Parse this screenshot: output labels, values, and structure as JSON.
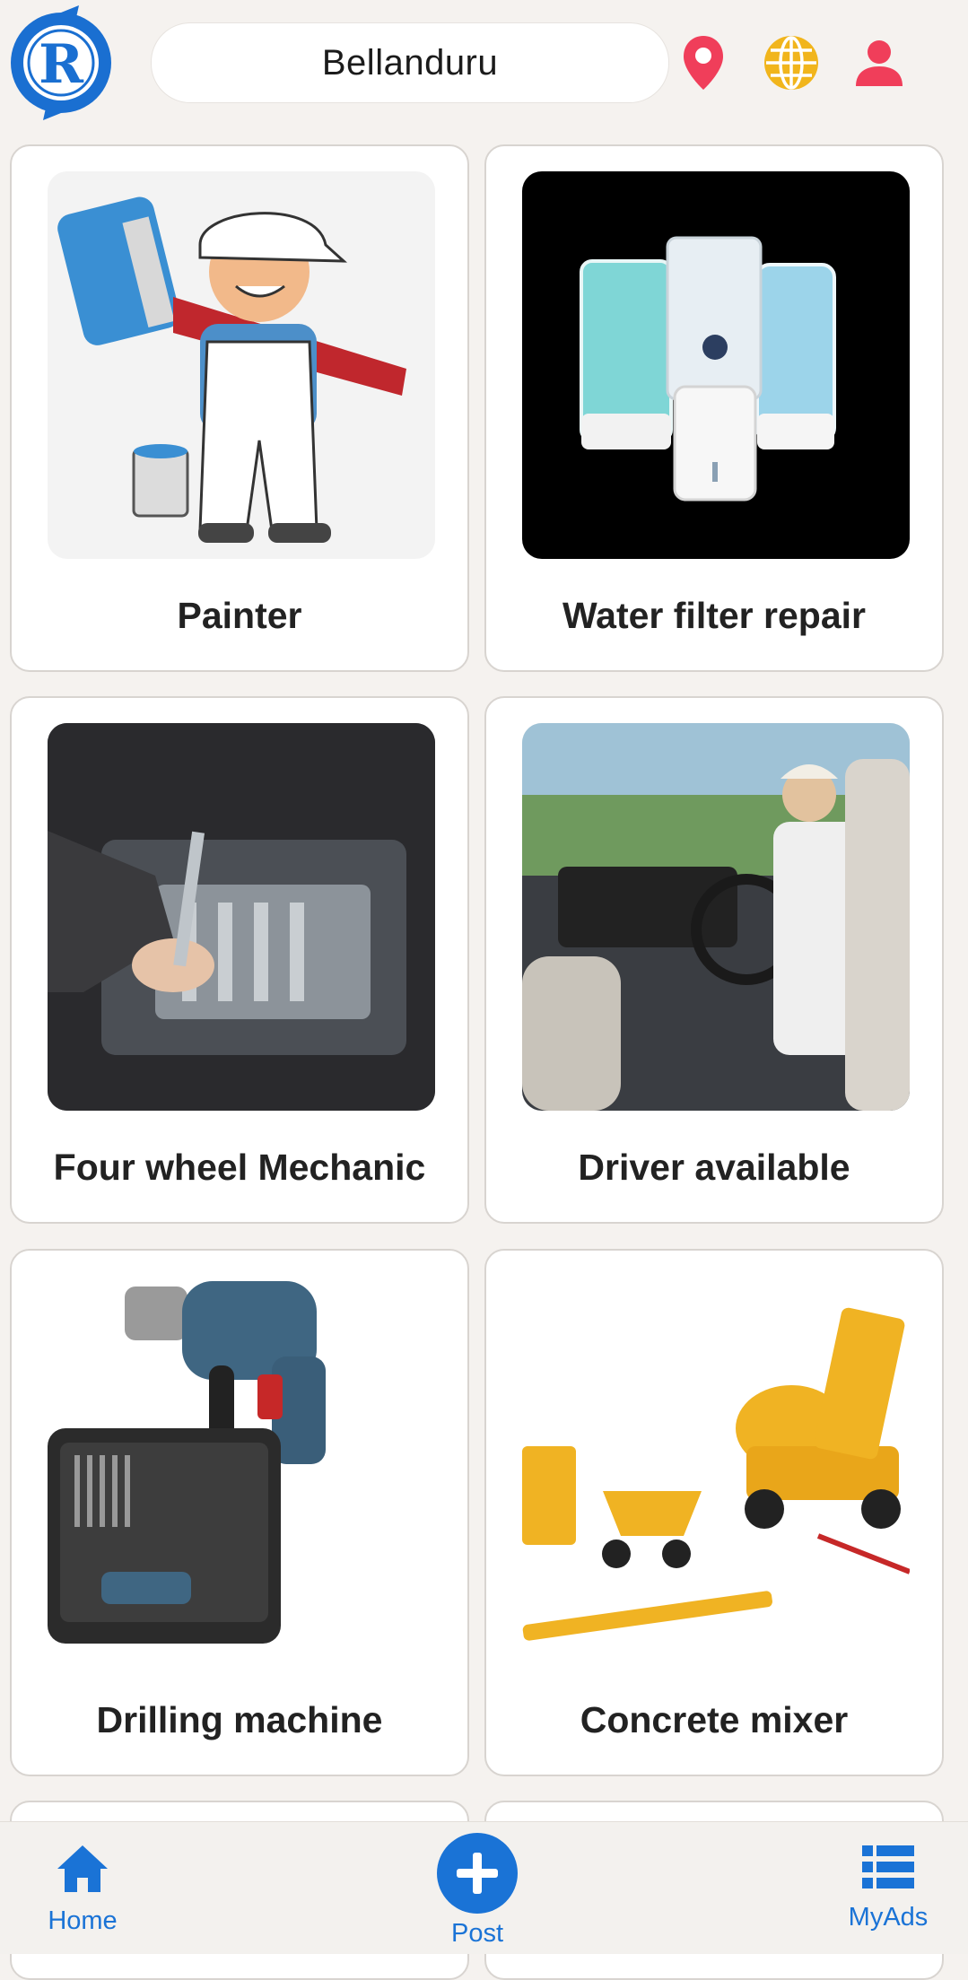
{
  "header": {
    "location": "Bellanduru",
    "icons": [
      "app-logo-icon",
      "map-pin-icon",
      "globe-icon",
      "user-icon"
    ],
    "colors": {
      "logo": "#1a6fd1",
      "pin": "#f03e5a",
      "globe": "#f1b51c",
      "user": "#f03e5a"
    }
  },
  "categories": [
    {
      "label": "Painter"
    },
    {
      "label": "Water filter repair"
    },
    {
      "label": "Four wheel Mechanic"
    },
    {
      "label": "Driver available"
    },
    {
      "label": "Drilling machine"
    },
    {
      "label": "Concrete mixer"
    }
  ],
  "nav": {
    "home": "Home",
    "post": "Post",
    "myads": "MyAds",
    "accent": "#1a73d6"
  }
}
